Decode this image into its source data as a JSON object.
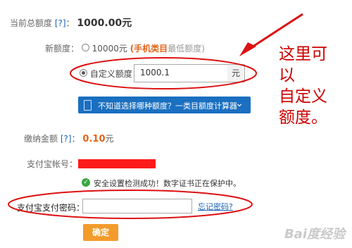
{
  "total_quota": {
    "label": "当前总额度",
    "help": "[?]",
    "sep": "：",
    "value": "1000.00元"
  },
  "new_quota": {
    "label": "新额度：",
    "option_10000": {
      "value": "10000元",
      "paren_open": "(",
      "category": "手机类目",
      "min_text": "最低额度)"
    },
    "option_custom": {
      "label": "自定义额度",
      "input_value": "1000.1",
      "unit": "元"
    }
  },
  "calculator": {
    "label": "不知道选择哪种额度？一类目额度计算器"
  },
  "payment": {
    "label": "缴纳金额",
    "help": "[?]",
    "sep": "：",
    "value": "0.10",
    "unit": "元"
  },
  "alipay_account": {
    "label": "支付宝帐号："
  },
  "security_status": {
    "text": "安全设置检测成功！数字证书正在保护中。"
  },
  "password": {
    "label": "支付宝支付密码：",
    "forgot": "忘记密码?"
  },
  "confirm": {
    "label": "确定"
  },
  "annotation": {
    "lines": [
      "这里可",
      "以",
      "自定义",
      "额度。"
    ]
  },
  "watermark": {
    "text": "Bai度经验"
  },
  "colors": {
    "accent_orange": "#e3641a",
    "link_blue": "#1a62b6",
    "button_blue": "#1a6fc0",
    "annotation_red": "#cc0000",
    "success_green": "#3aa641"
  }
}
